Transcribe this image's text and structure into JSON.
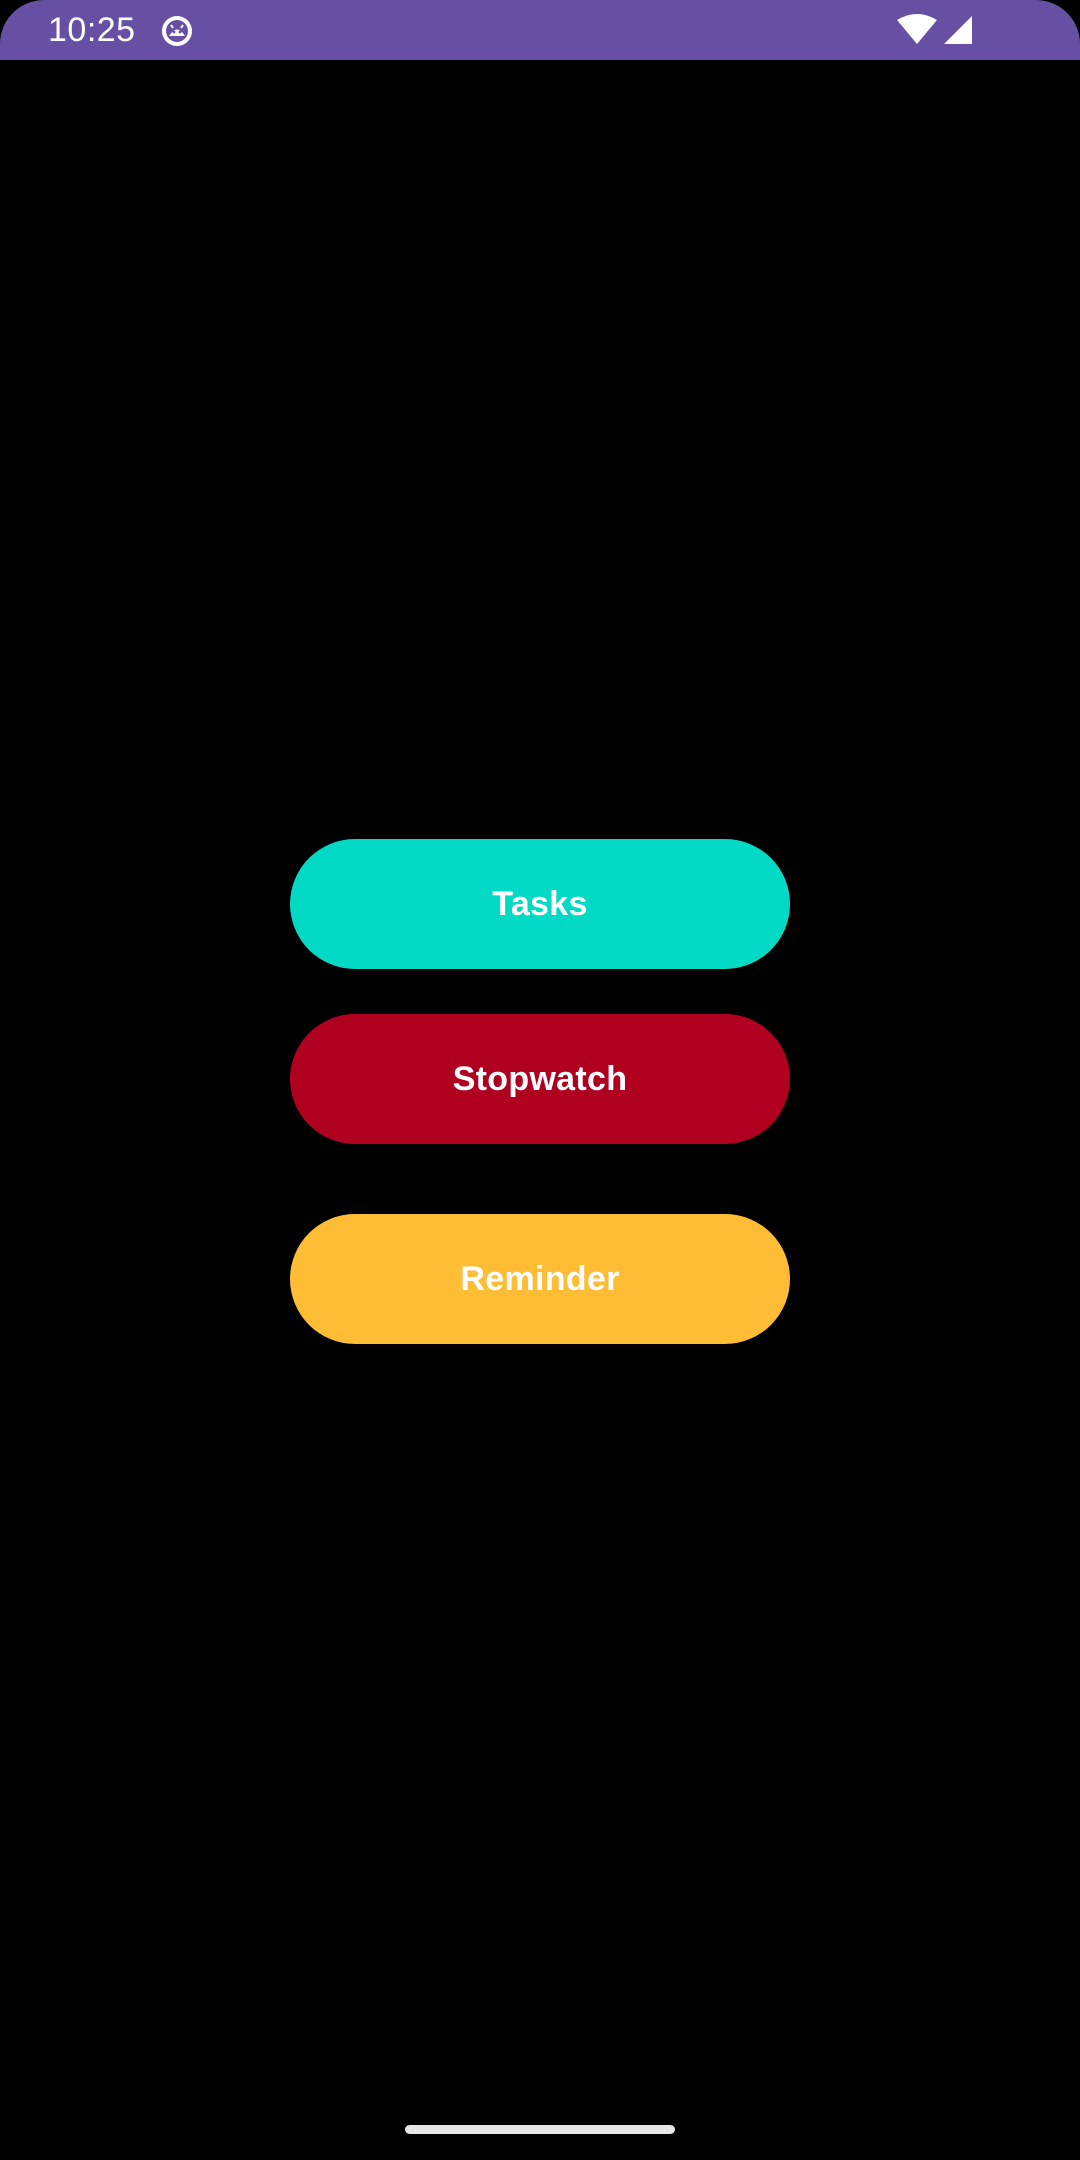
{
  "status_bar": {
    "time": "10:25",
    "background_color": "#6750a4",
    "app_icon": "android-debug-icon",
    "wifi_icon": "wifi-icon",
    "signal_icon": "cellular-signal-icon"
  },
  "main": {
    "buttons": [
      {
        "label": "Tasks",
        "color": "#03dac6"
      },
      {
        "label": "Stopwatch",
        "color": "#b00020"
      },
      {
        "label": "Reminder",
        "color": "#ffbd35"
      }
    ]
  },
  "navigation": {
    "gesture_bar_icon": "gesture-handle-icon"
  }
}
